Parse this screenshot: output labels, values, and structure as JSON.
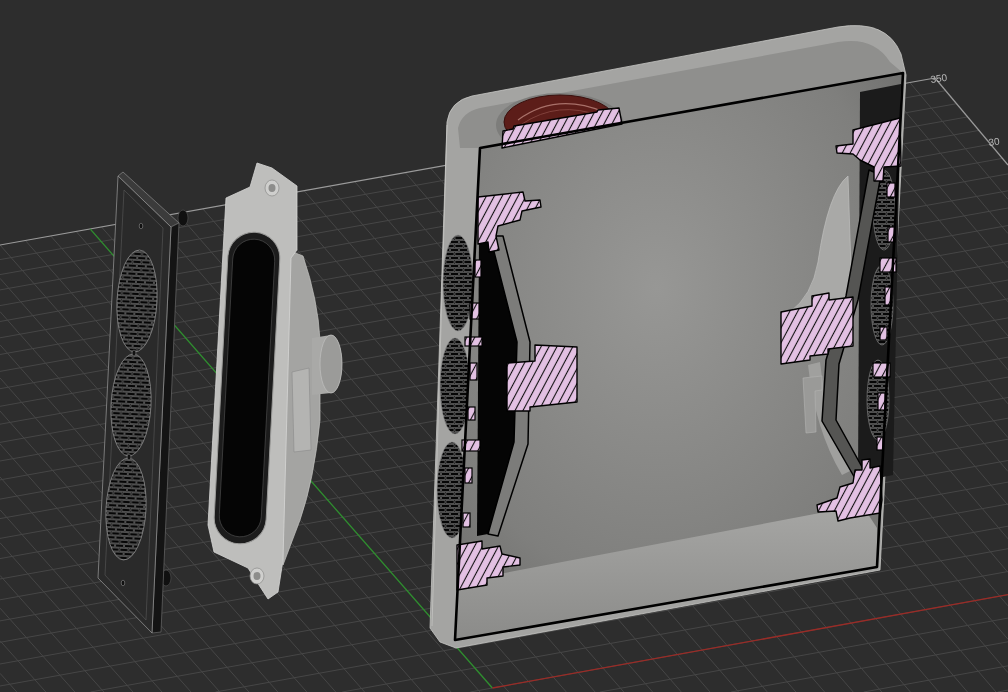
{
  "viewport": {
    "grid_labels": [
      "350",
      "30"
    ],
    "objects": [
      {
        "kind": "grille_plate"
      },
      {
        "kind": "speaker_driver"
      },
      {
        "kind": "enclosure_section"
      }
    ]
  }
}
